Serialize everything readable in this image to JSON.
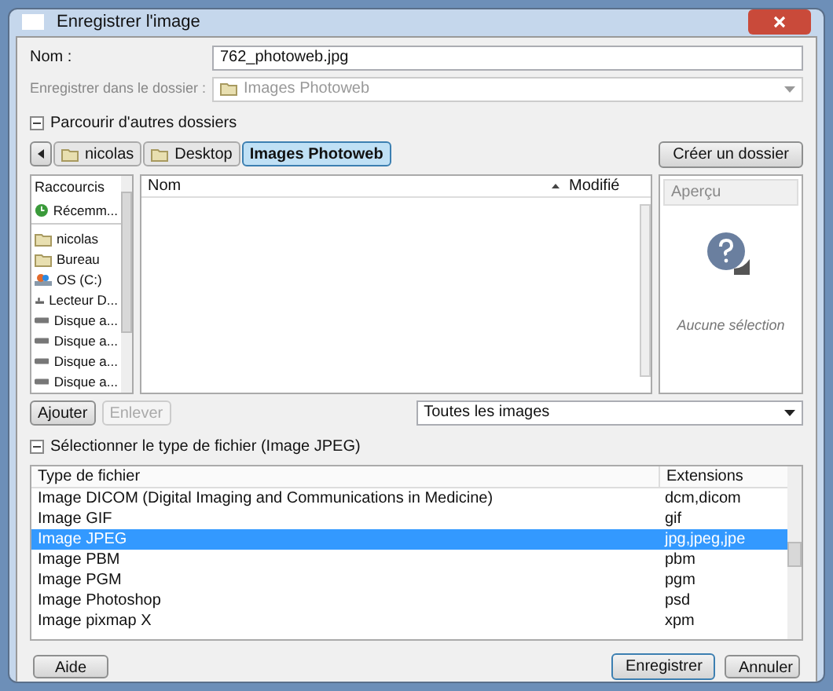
{
  "window": {
    "title": "Enregistrer l'image"
  },
  "name_field": {
    "label": "Nom :",
    "value": "762_photoweb.jpg"
  },
  "folder_field": {
    "label": "Enregistrer dans le dossier :",
    "value": "Images Photoweb",
    "disabled": true
  },
  "browse_expander": {
    "label": "Parcourir d'autres dossiers",
    "expanded": true
  },
  "path_bar": [
    {
      "label": "nicolas",
      "selected": false,
      "folder": true
    },
    {
      "label": "Desktop",
      "selected": false,
      "folder": true
    },
    {
      "label": "Images Photoweb",
      "selected": true,
      "folder": false
    }
  ],
  "create_folder_button": "Créer un dossier",
  "shortcuts": {
    "header": "Raccourcis",
    "items": [
      {
        "label": "Récemm...",
        "kind": "recent"
      },
      {
        "label": "nicolas",
        "kind": "folder"
      },
      {
        "label": "Bureau",
        "kind": "folder"
      },
      {
        "label": "OS (C:)",
        "kind": "drive"
      },
      {
        "label": "Lecteur D...",
        "kind": "optical"
      },
      {
        "label": "Disque a...",
        "kind": "disk"
      },
      {
        "label": "Disque a...",
        "kind": "disk"
      },
      {
        "label": "Disque a...",
        "kind": "disk"
      },
      {
        "label": "Disque a...",
        "kind": "disk"
      }
    ]
  },
  "files": {
    "columns": [
      "Nom",
      "Modifié"
    ]
  },
  "preview": {
    "header": "Aperçu",
    "message": "Aucune sélection"
  },
  "add_button": {
    "label": "Ajouter",
    "disabled": false
  },
  "remove_button": {
    "label": "Enlever",
    "disabled": true
  },
  "filter": {
    "value": "Toutes les images"
  },
  "type_expander": {
    "label": "Sélectionner le type de fichier (Image JPEG)",
    "expanded": true
  },
  "file_types": {
    "columns": [
      "Type de fichier",
      "Extensions"
    ],
    "rows": [
      {
        "type": "Image DICOM (Digital Imaging and Communications in Medicine)",
        "ext": "dcm,dicom",
        "selected": false
      },
      {
        "type": "Image GIF",
        "ext": "gif",
        "selected": false
      },
      {
        "type": "Image JPEG",
        "ext": "jpg,jpeg,jpe",
        "selected": true
      },
      {
        "type": "Image PBM",
        "ext": "pbm",
        "selected": false
      },
      {
        "type": "Image PGM",
        "ext": "pgm",
        "selected": false
      },
      {
        "type": "Image Photoshop",
        "ext": "psd",
        "selected": false
      },
      {
        "type": "Image pixmap X",
        "ext": "xpm",
        "selected": false
      }
    ]
  },
  "buttons": {
    "help": "Aide",
    "save": "Enregistrer",
    "cancel": "Annuler"
  }
}
